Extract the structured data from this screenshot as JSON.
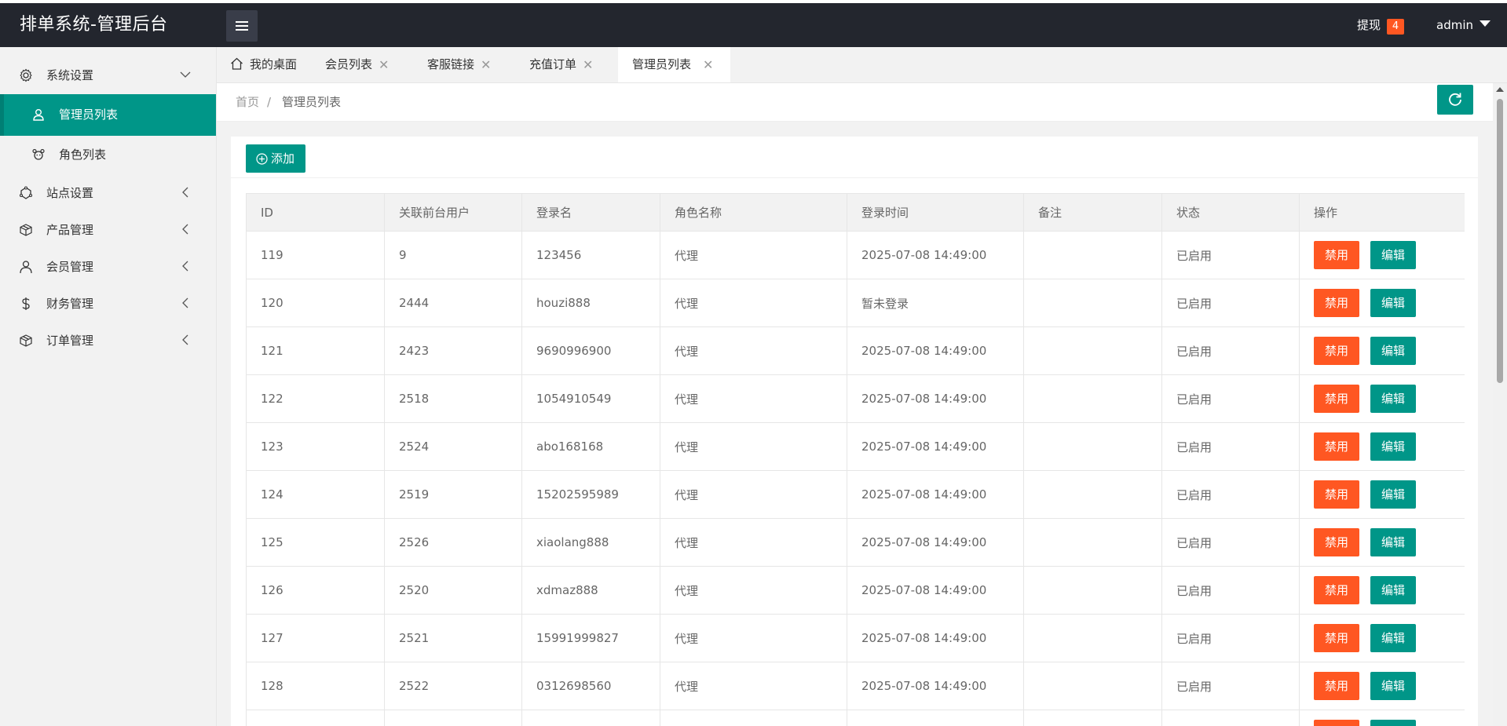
{
  "header": {
    "title": "排单系统-管理后台",
    "withdraw_label": "提现",
    "withdraw_count": "4",
    "user": "admin"
  },
  "sidebar": {
    "items": [
      {
        "label": "系统设置",
        "icon": "gear-icon"
      },
      {
        "label": "管理员列表",
        "icon": "user-icon"
      },
      {
        "label": "角色列表",
        "icon": "role-icon"
      },
      {
        "label": "站点设置",
        "icon": "site-icon"
      },
      {
        "label": "产品管理",
        "icon": "package-icon"
      },
      {
        "label": "会员管理",
        "icon": "user-icon"
      },
      {
        "label": "财务管理",
        "icon": "dollar-icon"
      },
      {
        "label": "订单管理",
        "icon": "package-icon"
      }
    ]
  },
  "tabs": [
    {
      "label": "我的桌面"
    },
    {
      "label": "会员列表"
    },
    {
      "label": "客服链接"
    },
    {
      "label": "充值订单"
    },
    {
      "label": "管理员列表"
    }
  ],
  "breadcrumb": {
    "home": "首页",
    "sep": "/",
    "current": "管理员列表"
  },
  "toolbar": {
    "add_label": "添加"
  },
  "table": {
    "headers": [
      "ID",
      "关联前台用户",
      "登录名",
      "角色名称",
      "登录时间",
      "备注",
      "状态",
      "操作"
    ],
    "disable_label": "禁用",
    "edit_label": "编辑",
    "rows": [
      [
        "119",
        "9",
        "123456",
        "代理",
        "2025-07-08 14:49:00",
        "",
        "已启用"
      ],
      [
        "120",
        "2444",
        "houzi888",
        "代理",
        "暂未登录",
        "",
        "已启用"
      ],
      [
        "121",
        "2423",
        "9690996900",
        "代理",
        "2025-07-08 14:49:00",
        "",
        "已启用"
      ],
      [
        "122",
        "2518",
        "1054910549",
        "代理",
        "2025-07-08 14:49:00",
        "",
        "已启用"
      ],
      [
        "123",
        "2524",
        "abo168168",
        "代理",
        "2025-07-08 14:49:00",
        "",
        "已启用"
      ],
      [
        "124",
        "2519",
        "15202595989",
        "代理",
        "2025-07-08 14:49:00",
        "",
        "已启用"
      ],
      [
        "125",
        "2526",
        "xiaolang888",
        "代理",
        "2025-07-08 14:49:00",
        "",
        "已启用"
      ],
      [
        "126",
        "2520",
        "xdmaz888",
        "代理",
        "2025-07-08 14:49:00",
        "",
        "已启用"
      ],
      [
        "127",
        "2521",
        "15991999827",
        "代理",
        "2025-07-08 14:49:00",
        "",
        "已启用"
      ],
      [
        "128",
        "2522",
        "0312698560",
        "代理",
        "2025-07-08 14:49:00",
        "",
        "已启用"
      ]
    ]
  },
  "colors": {
    "header_bg": "#23262e",
    "accent": "#009688",
    "danger": "#ff5722"
  }
}
